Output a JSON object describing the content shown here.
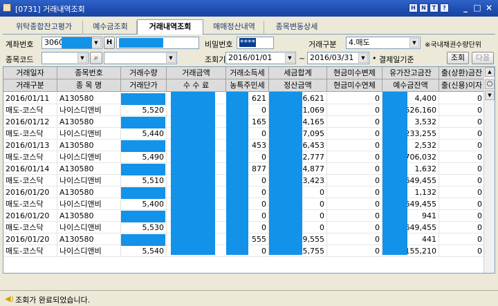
{
  "window": {
    "title": "[0731] 거래내역조회",
    "title_buttons": [
      "H",
      "N",
      "T",
      "?"
    ],
    "controls": [
      "_",
      "□",
      "×"
    ]
  },
  "tabs": [
    {
      "label": "위탁종합잔고평가",
      "active": false
    },
    {
      "label": "예수금조회",
      "active": false
    },
    {
      "label": "거래내역조회",
      "active": true
    },
    {
      "label": "매매정산내역",
      "active": false
    },
    {
      "label": "종목변동상세",
      "active": false
    }
  ],
  "form": {
    "account_label": "계좌번호",
    "account_prefix": "3060",
    "account_button": "H",
    "password_label": "비밀번호",
    "password_value": "****",
    "trade_type_label": "거래구분",
    "trade_type_value": "4.매도",
    "trade_note": "※국내채권수량단위",
    "stock_code_label": "종목코드",
    "period_label": "조회기간",
    "date_from": "2016/01/01",
    "tilde": "~",
    "date_to": "2016/03/31",
    "settle_basis": "결제일기준",
    "query_button": "조회",
    "next_button": "다음"
  },
  "grid": {
    "header_row1": [
      "거래일자",
      "종목번호",
      "거래수량",
      "거래금액",
      "거래소득세",
      "세금합계",
      "현금미수변제",
      "유가잔고금잔",
      "출(상환)금잔"
    ],
    "header_row2": [
      "거래구분",
      "종 목 명",
      "거래단가",
      "수 수 료",
      "농특주민세",
      "정산금액",
      "현금미수연체",
      "예수금잔액",
      "출(신용)이자"
    ],
    "rows": [
      {
        "c1": "2016/01/11",
        "c2": "A130580",
        "c3": "",
        "c5": "621",
        "c6": "6,621",
        "c7": "0",
        "c8": "4,400",
        "c9": "0"
      },
      {
        "c1": "매도-코스닥",
        "c2": "나이스디앤비",
        "c3": "5,520",
        "c5": "0",
        "c6": "1,069",
        "c7": "0",
        "c8": "526,160",
        "c9": "0"
      },
      {
        "c1": "2016/01/12",
        "c2": "A130580",
        "c3": "",
        "c5": "165",
        "c6": "4,165",
        "c7": "0",
        "c8": "3,532",
        "c9": "0"
      },
      {
        "c1": "매도-코스닥",
        "c2": "나이스디앤비",
        "c3": "5,440",
        "c5": "0",
        "c6": "7,095",
        "c7": "0",
        "c8": "233,255",
        "c9": "0"
      },
      {
        "c1": "2016/01/13",
        "c2": "A130580",
        "c3": "",
        "c5": "453",
        "c6": "6,453",
        "c7": "0",
        "c8": "2,532",
        "c9": "0"
      },
      {
        "c1": "매도-코스닥",
        "c2": "나이스디앤비",
        "c3": "5,490",
        "c5": "0",
        "c6": "2,777",
        "c7": "0",
        "c8": "706,032",
        "c9": "0"
      },
      {
        "c1": "2016/01/14",
        "c2": "A130580",
        "c3": "",
        "c5": "877",
        "c6": "4,877",
        "c7": "0",
        "c8": "1,632",
        "c9": "0"
      },
      {
        "c1": "매도-코스닥",
        "c2": "나이스디앤비",
        "c3": "5,510",
        "c5": "0",
        "c6": "3,423",
        "c7": "0",
        "c8": "649,455",
        "c9": "0"
      },
      {
        "c1": "2016/01/20",
        "c2": "A130580",
        "c3": "",
        "c5": "0",
        "c6": "0",
        "c7": "0",
        "c8": "1,132",
        "c9": "0"
      },
      {
        "c1": "매도-코스닥",
        "c2": "나이스디앤비",
        "c3": "5,400",
        "c5": "0",
        "c6": "0",
        "c7": "0",
        "c8": "649,455",
        "c9": "0"
      },
      {
        "c1": "2016/01/20",
        "c2": "A130580",
        "c3": "",
        "c5": "0",
        "c6": "0",
        "c7": "0",
        "c8": "941",
        "c9": "0"
      },
      {
        "c1": "매도-코스닥",
        "c2": "나이스디앤비",
        "c3": "5,530",
        "c5": "0",
        "c6": "0",
        "c7": "0",
        "c8": "649,455",
        "c9": "0"
      },
      {
        "c1": "2016/01/20",
        "c2": "A130580",
        "c3": "",
        "c5": "555",
        "c6": "9,555",
        "c7": "0",
        "c8": "441",
        "c9": "0"
      },
      {
        "c1": "매도-코스닥",
        "c2": "나이스디앤비",
        "c3": "5,540",
        "c5": "0",
        "c6": "5,755",
        "c7": "0",
        "c8": "155,210",
        "c9": "0"
      }
    ]
  },
  "status": {
    "message": "조회가 완료되었습니다."
  },
  "colors": {
    "mask": "#1292e8",
    "title_bar": "#1e4db0"
  }
}
